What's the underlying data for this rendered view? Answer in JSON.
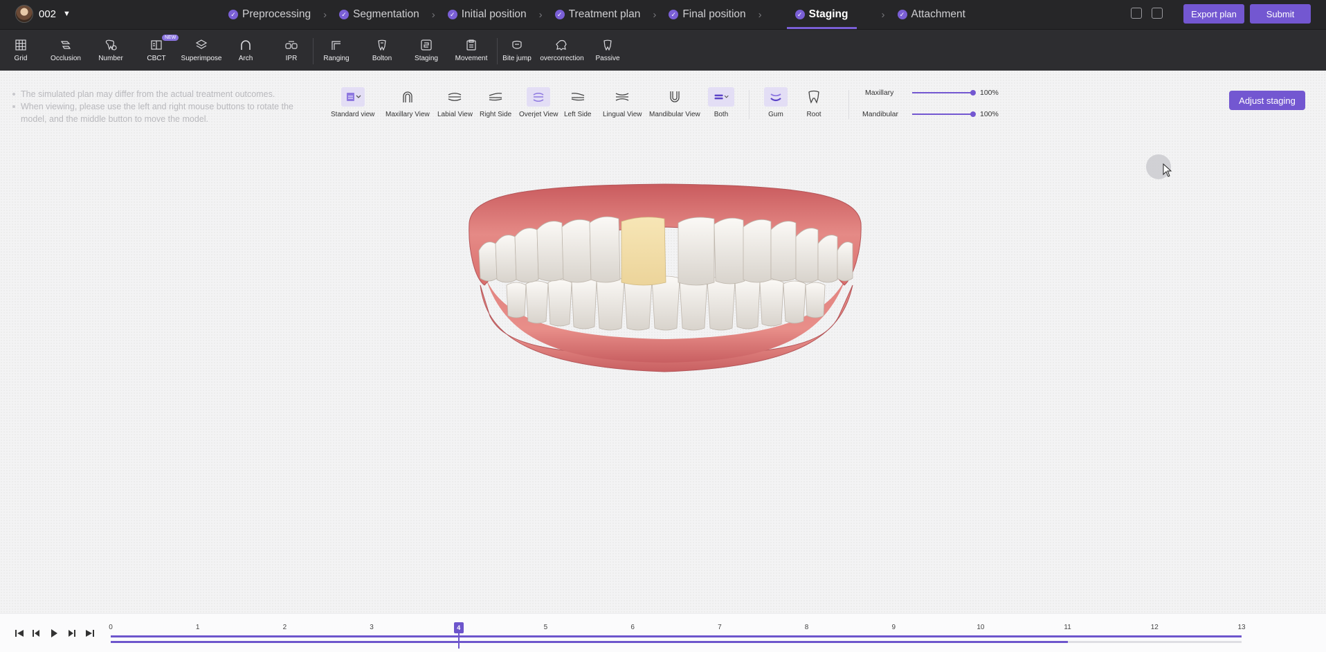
{
  "user": {
    "name": "002"
  },
  "steps": [
    {
      "label": "Preprocessing",
      "done": true
    },
    {
      "label": "Segmentation",
      "done": true
    },
    {
      "label": "Initial position",
      "done": true
    },
    {
      "label": "Treatment plan",
      "done": true
    },
    {
      "label": "Final position",
      "done": true
    },
    {
      "label": "Staging",
      "done": true,
      "active": true
    },
    {
      "label": "Attachment",
      "done": true
    }
  ],
  "header": {
    "export_label": "Export plan",
    "submit_label": "Submit"
  },
  "toolbar": {
    "items": [
      {
        "label": "Grid",
        "icon": "grid-icon"
      },
      {
        "label": "Occlusion",
        "icon": "occlusion-icon"
      },
      {
        "label": "Number",
        "icon": "number-icon"
      },
      {
        "label": "CBCT",
        "icon": "cbct-icon",
        "badge": "NEW"
      },
      {
        "label": "Superimpose",
        "icon": "superimpose-icon"
      },
      {
        "label": "Arch",
        "icon": "arch-icon"
      },
      {
        "label": "IPR",
        "icon": "ipr-icon"
      },
      {
        "label": "Ranging",
        "icon": "ranging-icon"
      },
      {
        "label": "Bolton",
        "icon": "bolton-icon"
      },
      {
        "label": "Staging",
        "icon": "staging-icon"
      },
      {
        "label": "Movement",
        "icon": "movement-icon"
      },
      {
        "label": "Bite jump",
        "icon": "bite-jump-icon"
      },
      {
        "label": "overcorrection",
        "icon": "overcorrection-icon"
      },
      {
        "label": "Passive",
        "icon": "passive-icon"
      }
    ]
  },
  "notes": [
    "The simulated plan may differ from the actual treatment outcomes.",
    "When viewing, please use the left and right mouse buttons to rotate the model, and the middle button to move the model."
  ],
  "views": [
    {
      "label": "Standard view",
      "icon": "standard-view-icon",
      "selected": true,
      "dropdown": true
    },
    {
      "label": "Maxillary View",
      "icon": "maxillary-view-icon"
    },
    {
      "label": "Labial View",
      "icon": "labial-view-icon"
    },
    {
      "label": "Right Side",
      "icon": "right-side-icon"
    },
    {
      "label": "Overjet View",
      "icon": "overjet-view-icon",
      "selected": true
    },
    {
      "label": "Left Side",
      "icon": "left-side-icon"
    },
    {
      "label": "Lingual View",
      "icon": "lingual-view-icon"
    },
    {
      "label": "Mandibular View",
      "icon": "mandibular-view-icon"
    },
    {
      "label": "Both",
      "icon": "both-jaws-icon",
      "selected": true,
      "dropdown": true
    },
    {
      "label": "Gum",
      "icon": "gum-icon",
      "selected": true
    },
    {
      "label": "Root",
      "icon": "root-icon"
    }
  ],
  "opacity": {
    "maxillary": {
      "label": "Maxillary",
      "value": "100%",
      "level": 1.0
    },
    "mandibular": {
      "label": "Mandibular",
      "value": "100%",
      "level": 1.0
    }
  },
  "adjust_label": "Adjust staging",
  "timeline": {
    "ticks": [
      "0",
      "1",
      "2",
      "3",
      "4",
      "5",
      "6",
      "7",
      "8",
      "9",
      "10",
      "11",
      "12",
      "13"
    ],
    "current_stage": "4",
    "current_index": 4,
    "max_index": 13,
    "lower_progress_stage": 11
  },
  "colors": {
    "accent": "#7357d1",
    "topbar": "#262628",
    "toolbar": "#2d2d30"
  }
}
